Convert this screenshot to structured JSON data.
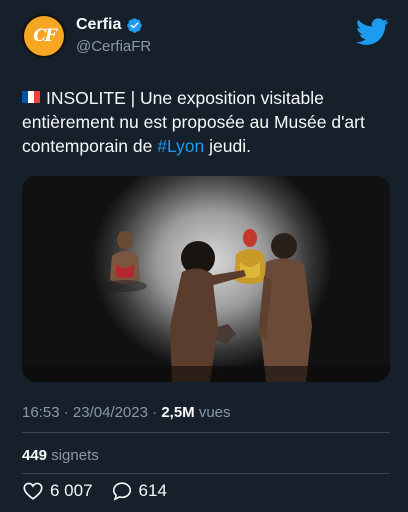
{
  "author": {
    "display_name": "Cerfia",
    "handle": "@CerfiaFR",
    "avatar_text": "CF",
    "verified": true
  },
  "tweet": {
    "text_before_hashtag": "INSOLITE | Une exposition visitable entièrement nu est proposée au Musée d'art contemporain de ",
    "hashtag": "#Lyon",
    "text_after_hashtag": " jeudi.",
    "flag": "french-flag"
  },
  "meta": {
    "time": "16:53",
    "separator": "·",
    "date": "23/04/2023",
    "views_count": "2,5M",
    "views_label": "vues",
    "bookmarks_count": "449",
    "bookmarks_label": "signets"
  },
  "actions": {
    "likes": "6 007",
    "replies": "614"
  },
  "colors": {
    "background": "#15202b",
    "accent": "#1d9bf0",
    "secondary_text": "#8b98a5",
    "avatar_orange": "#f5a623"
  }
}
